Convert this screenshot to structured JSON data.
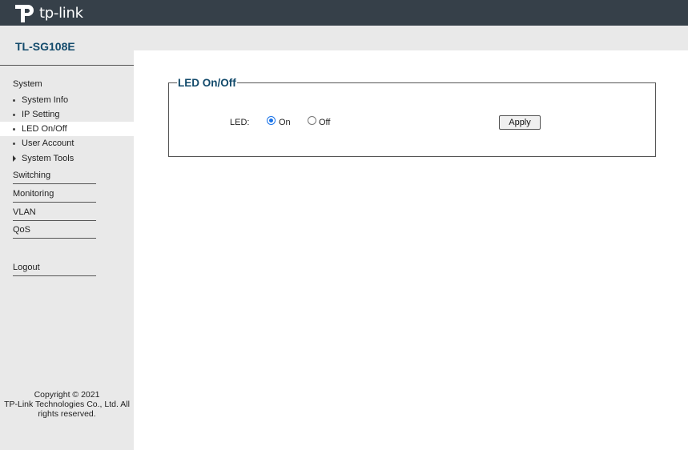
{
  "header": {
    "logo_text": "tp-link"
  },
  "sidebar": {
    "model": "TL-SG108E",
    "group_system": "System",
    "sub_items": [
      {
        "label": "System Info"
      },
      {
        "label": "IP Setting"
      },
      {
        "label": "LED On/Off"
      },
      {
        "label": "User Account"
      },
      {
        "label": "System Tools"
      }
    ],
    "main_items": [
      {
        "label": "Switching"
      },
      {
        "label": "Monitoring"
      },
      {
        "label": "VLAN"
      },
      {
        "label": "QoS"
      },
      {
        "label": "Logout"
      }
    ],
    "copyright": [
      "Copyright © 2021",
      "TP-Link Technologies Co., Ltd. All",
      "rights reserved."
    ]
  },
  "panel": {
    "legend": "LED On/Off",
    "led_label": "LED:",
    "option_on": "On",
    "option_off": "Off",
    "selected": "On",
    "apply_label": "Apply"
  },
  "colors": {
    "header_bg": "#364049",
    "accent": "#124a6b",
    "sidebar_bg": "#e9e9e9"
  }
}
